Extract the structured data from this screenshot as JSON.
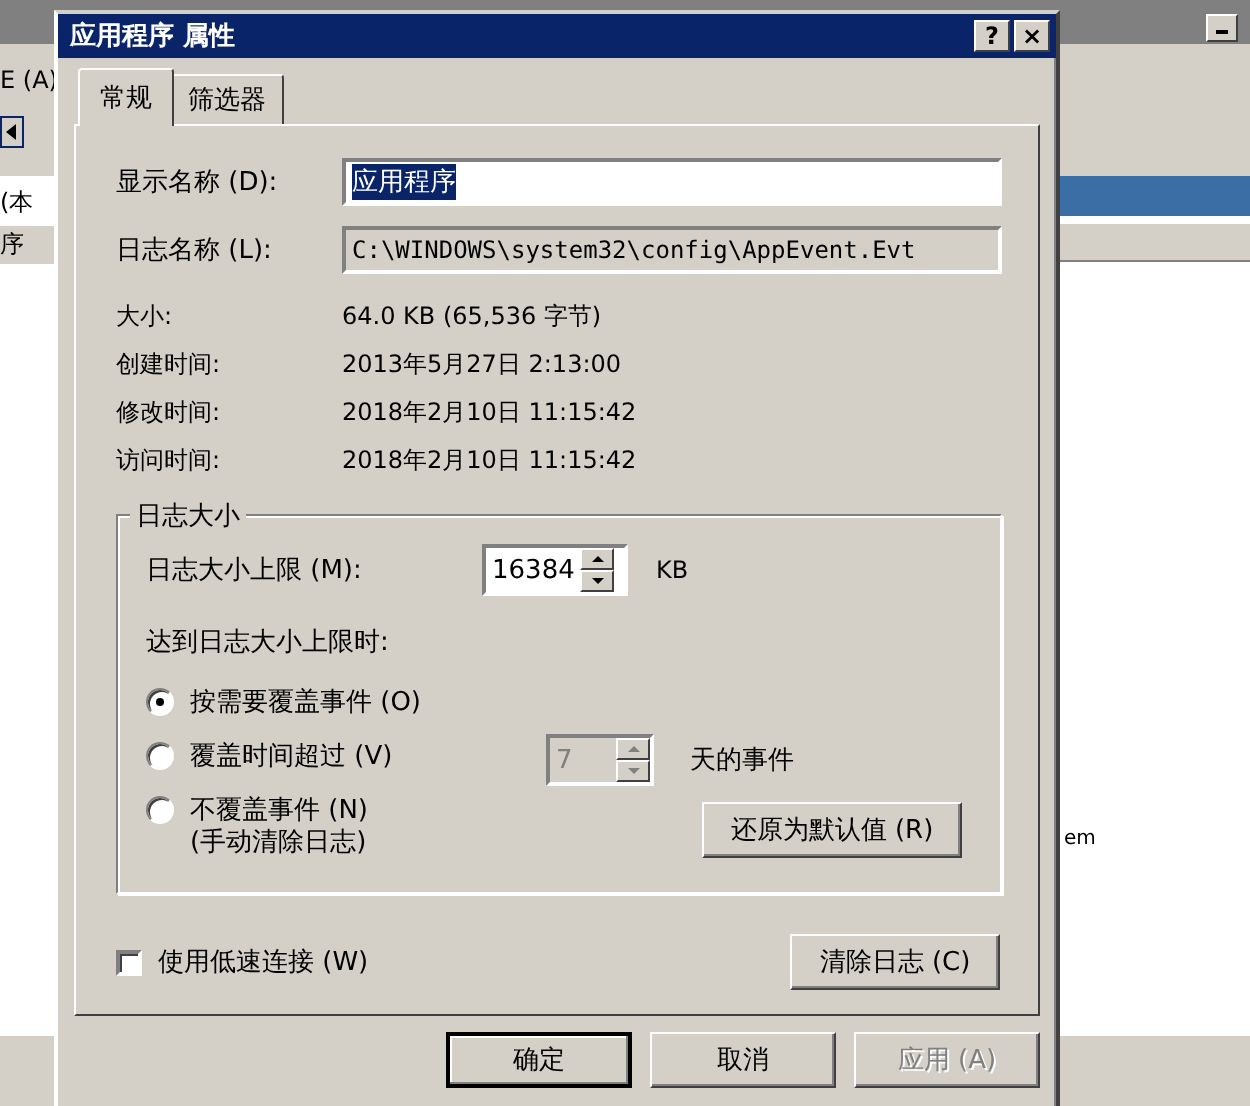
{
  "background_window": {
    "menu_fragment": "E (A)",
    "tree_items": [
      {
        "label": "(本",
        "selected": false
      },
      {
        "label": "序",
        "selected": true
      }
    ],
    "list_fragment": "em"
  },
  "dialog": {
    "title": "应用程序 属性",
    "help_button": "?",
    "close_button": "×"
  },
  "tabs": [
    {
      "label": "常规",
      "selected": true
    },
    {
      "label": "筛选器",
      "selected": false
    }
  ],
  "display_name": {
    "label": "显示名称 (D):",
    "value": "应用程序",
    "text_selected": true
  },
  "log_name": {
    "label": "日志名称 (L):",
    "value": "C:\\WINDOWS\\system32\\config\\AppEvent.Evt",
    "disabled": true
  },
  "info": [
    {
      "label": "大小:",
      "value": "64.0 KB (65,536 字节)"
    },
    {
      "label": "创建时间:",
      "value": "2013年5月27日 2:13:00"
    },
    {
      "label": "修改时间:",
      "value": "2018年2月10日 11:15:42"
    },
    {
      "label": "访问时间:",
      "value": "2018年2月10日 11:15:42"
    }
  ],
  "log_size": {
    "title": "日志大小",
    "max_label": "日志大小上限 (M):",
    "max_value": "16384",
    "unit": "KB",
    "when_full_label": "达到日志大小上限时:",
    "options": [
      {
        "label": "按需要覆盖事件 (O)",
        "selected": true
      },
      {
        "label": "覆盖时间超过 (V)",
        "selected": false
      },
      {
        "label": "不覆盖事件 (N)",
        "note": "(手动清除日志)",
        "selected": false
      }
    ],
    "days": {
      "value": "7",
      "disabled": true,
      "unit": "天的事件"
    },
    "restore_button": "还原为默认值 (R)"
  },
  "low_speed": {
    "label": "使用低速连接 (W)",
    "checked": false
  },
  "clear_button": "清除日志 (C)",
  "buttons": [
    {
      "label": "确定",
      "default": true,
      "disabled": false
    },
    {
      "label": "取消",
      "default": false,
      "disabled": false
    },
    {
      "label": "应用 (A)",
      "default": false,
      "disabled": true
    }
  ]
}
